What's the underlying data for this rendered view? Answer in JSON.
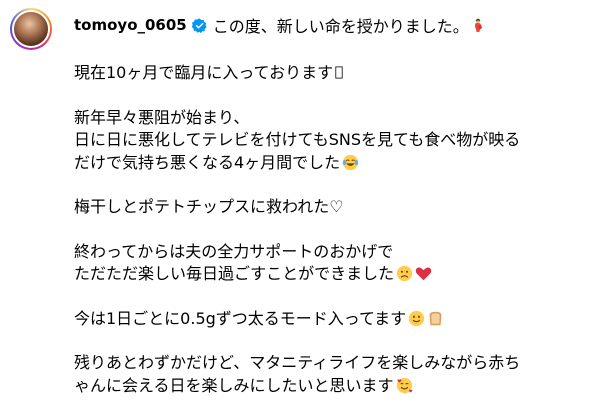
{
  "post": {
    "username": "tomoyo_0605",
    "icons": {
      "verified": "verified-badge-icon",
      "pregnant": "pregnant-woman-emoji",
      "tofu": "missing-glyph-icon",
      "laugh": "laughing-tears-emoji",
      "heart_suit": "white-heart-suit",
      "sad": "sad-face-emoji",
      "heart": "red-heart-emoji",
      "smile": "slightly-smiling-face-emoji",
      "bread": "bread-emoji",
      "love": "smiling-face-with-hearts-emoji"
    },
    "caption": {
      "first_line": "この度、新しい命を授かりました。",
      "p1_line1": "現在10ヶ月で臨月に入っております",
      "p2_line1": "新年早々悪阻が始まり、",
      "p2_line2": "日に日に悪化してテレビを付けてもSNSを見ても食べ物が映る",
      "p2_line3": "だけで気持ち悪くなる4ヶ月間でした",
      "p3_line1": "梅干しとポテトチップスに救われた♡",
      "p4_line1": "終わってからは夫の全力サポートのおかげで",
      "p4_line2": "ただただ楽しい毎日過ごすことができました",
      "p5_line1": "今は1日ごとに0.5gずつ太るモード入ってます",
      "p6_line1": "残りあとわずかだけど、マタニティライフを楽しみながら赤ち",
      "p6_line2": "ゃんに会える日を楽しみにしたいと思います"
    }
  },
  "colors": {
    "verified_blue": "#0095f6",
    "text": "#000000",
    "background": "#ffffff"
  }
}
